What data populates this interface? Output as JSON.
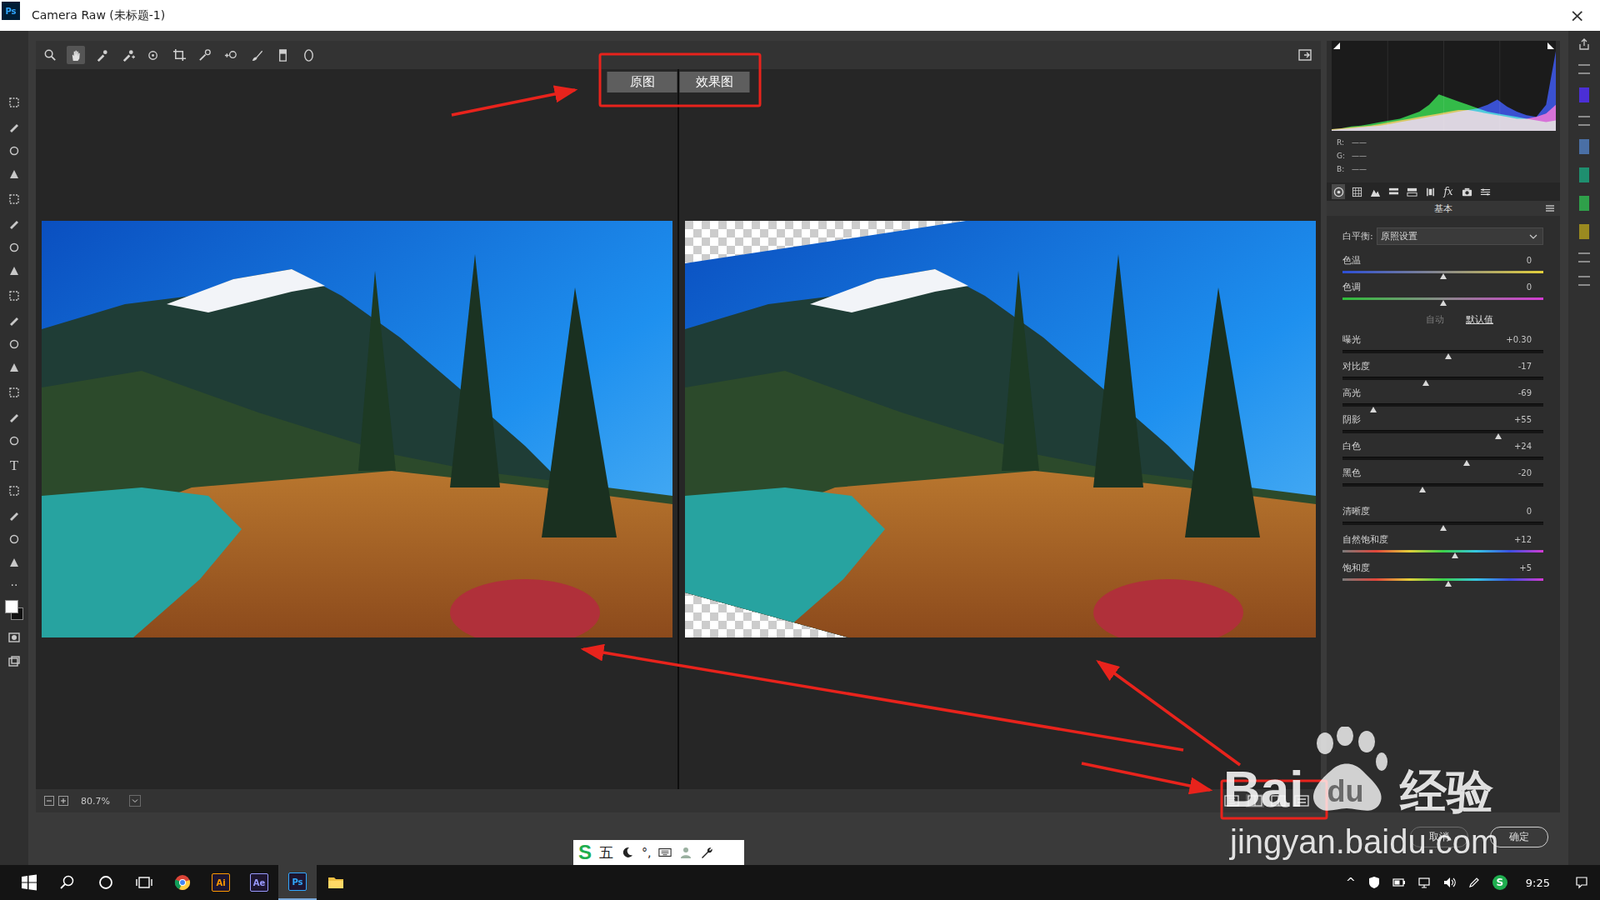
{
  "window": {
    "title": "Camera Raw (未标题-1)",
    "app_logo": "Ps",
    "close": "×"
  },
  "ps_toolbar": {
    "type_tool": "T",
    "more": "··"
  },
  "tools": [
    {
      "selected": false
    },
    {
      "selected": true
    },
    {
      "selected": false
    },
    {
      "selected": false
    },
    {
      "selected": false
    },
    {
      "selected": false
    },
    {
      "selected": false
    },
    {
      "selected": false
    },
    {
      "selected": false
    },
    {
      "selected": false
    },
    {
      "selected": false
    }
  ],
  "compare": {
    "labels": [
      "原图",
      "效果图"
    ]
  },
  "previews": [
    {
      "name": "before",
      "transparent_corners": false
    },
    {
      "name": "after",
      "transparent_corners": true
    }
  ],
  "zoom": {
    "value": "80.7%"
  },
  "view_modes": [
    {
      "selected": false
    },
    {
      "selected": true
    },
    {
      "selected": false
    },
    {
      "selected": false
    }
  ],
  "histogram": {
    "series": [
      {
        "name": "R",
        "color": "#ff3b30",
        "values": [
          2,
          3,
          4,
          5,
          6,
          8,
          10,
          12,
          14,
          16,
          18,
          20,
          22,
          24,
          24,
          22,
          20,
          18,
          16,
          14,
          14,
          16,
          20,
          30
        ]
      },
      {
        "name": "G",
        "color": "#22e040",
        "values": [
          2,
          3,
          5,
          6,
          8,
          10,
          12,
          14,
          18,
          22,
          30,
          42,
          38,
          34,
          30,
          26,
          22,
          20,
          18,
          16,
          14,
          12,
          10,
          12
        ]
      },
      {
        "name": "B",
        "color": "#2b4bff",
        "values": [
          1,
          2,
          3,
          4,
          5,
          6,
          8,
          10,
          12,
          14,
          16,
          18,
          20,
          22,
          24,
          26,
          30,
          36,
          28,
          22,
          18,
          16,
          30,
          92
        ]
      }
    ],
    "readouts": [
      {
        "label": "R:",
        "value": "——"
      },
      {
        "label": "G:",
        "value": "——"
      },
      {
        "label": "B:",
        "value": "——"
      }
    ]
  },
  "panel_tabs": [
    {
      "selected": true
    },
    {
      "selected": false
    },
    {
      "selected": false
    },
    {
      "selected": false
    },
    {
      "selected": false
    },
    {
      "selected": false
    },
    {
      "selected": false,
      "label": "fx"
    },
    {
      "selected": false
    },
    {
      "selected": false
    }
  ],
  "panel_title": "基本",
  "white_balance": {
    "label": "白平衡:",
    "value": "原照设置"
  },
  "color_sliders": [
    {
      "label": "色温",
      "value": "0",
      "level": 0.5,
      "kind": "temp"
    },
    {
      "label": "色调",
      "value": "0",
      "level": 0.5,
      "kind": "tint"
    }
  ],
  "auto_links": [
    {
      "label": "自动",
      "disabled": true
    },
    {
      "label": "默认值",
      "disabled": false
    }
  ],
  "tone_sliders": [
    {
      "label": "曝光",
      "value": "+0.30",
      "level": 0.525,
      "kind": "plain"
    },
    {
      "label": "对比度",
      "value": "-17",
      "level": 0.415,
      "kind": "plain"
    },
    {
      "label": "高光",
      "value": "-69",
      "level": 0.155,
      "kind": "plain"
    },
    {
      "label": "阴影",
      "value": "+55",
      "level": 0.775,
      "kind": "plain"
    },
    {
      "label": "白色",
      "value": "+24",
      "level": 0.62,
      "kind": "plain"
    },
    {
      "label": "黑色",
      "value": "-20",
      "level": 0.4,
      "kind": "plain"
    }
  ],
  "presence_sliders": [
    {
      "label": "清晰度",
      "value": "0",
      "level": 0.5,
      "kind": "plain"
    },
    {
      "label": "自然饱和度",
      "value": "+12",
      "level": 0.56,
      "kind": "saturation"
    },
    {
      "label": "饱和度",
      "value": "+5",
      "level": 0.525,
      "kind": "saturation"
    }
  ],
  "dialog_buttons": [
    {
      "label": "取消",
      "primary": false
    },
    {
      "label": "确定",
      "primary": true
    }
  ],
  "ime": {
    "logo": "S",
    "mode": "五",
    "punct": "°,"
  },
  "taskbar": {
    "apps": [
      {
        "label": "Ai",
        "color": "#ff9a00",
        "selected": false
      },
      {
        "label": "Ae",
        "color": "#9999ff",
        "selected": false
      },
      {
        "label": "Ps",
        "color": "#31a8ff",
        "selected": true
      }
    ],
    "tray_chevron": "^",
    "tray_logo": "S",
    "time": "9:25"
  },
  "watermark": {
    "brand_left": "Bai",
    "brand_paw": "du",
    "brand_cn": "经验",
    "url": "jingyan.baidu.com"
  }
}
